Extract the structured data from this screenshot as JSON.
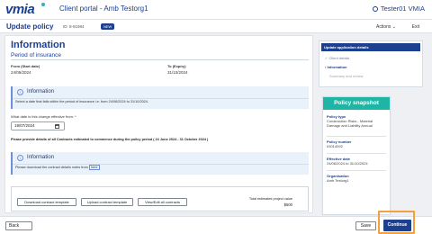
{
  "header": {
    "logo_text": "vmia",
    "portal_title": "Client portal - Amb Testorg1",
    "user_name": "Tester01 VMIA"
  },
  "subheader": {
    "title": "Update policy",
    "policy_id": "ID: 8-91984",
    "badge": "NEW",
    "actions_label": "Actions ⌄",
    "exit_label": "Exit"
  },
  "main": {
    "heading": "Information",
    "section_title": "Period of insurance",
    "from_label": "From (Start date)",
    "from_value": "24/06/2024",
    "to_label": "To (Expiry)",
    "to_value": "31/10/2024",
    "info_box_1": {
      "title": "Information",
      "body": "Select a date that falls within the period of insurance i.e. from 24/06/2024 to 31/10/2024."
    },
    "effective_question": "What date is this change effective from: *",
    "effective_value": "19/07/2024",
    "contracts_instruction": "Please provide details of all Contracts estimated to commence during the policy period ( 24 June 2024 - 31 October 2024 )",
    "info_box_2": {
      "title": "Information",
      "body_prefix": "Please download the contract details notes from",
      "link_text": "here"
    },
    "buttons": {
      "download_template": "Download contract template",
      "upload_template": "Upload contract template",
      "view_edit_all": "View/Edit all contracts"
    },
    "total_label": "Total estimated project value",
    "total_value": "$500"
  },
  "steps": {
    "header": "Update application details",
    "items": [
      {
        "label": "Client details",
        "status": "done",
        "marker": "✓"
      },
      {
        "label": "Information",
        "status": "active",
        "marker": "›"
      },
      {
        "label": "Summary and review",
        "status": "future",
        "marker": ""
      }
    ]
  },
  "snapshot": {
    "title": "Policy snapshot",
    "policy_type_label": "Policy type",
    "policy_type_value_1": "Construction Risks - Material",
    "policy_type_value_2": "Damage and Liability Annual",
    "policy_number_label": "Policy number",
    "policy_number_value": "03014092",
    "effective_date_label": "Effective date",
    "effective_date_value": "24/06/2024 to 31/10/2024",
    "organisation_label": "Organisation",
    "organisation_value": "Amb Testorg1"
  },
  "footer": {
    "back_label": "Back",
    "save_label": "Save",
    "continue_label": "Continue"
  },
  "colors": {
    "brand_blue": "#1d3f8f",
    "teal": "#1fb5a5",
    "highlight_orange": "#f2a13c"
  }
}
